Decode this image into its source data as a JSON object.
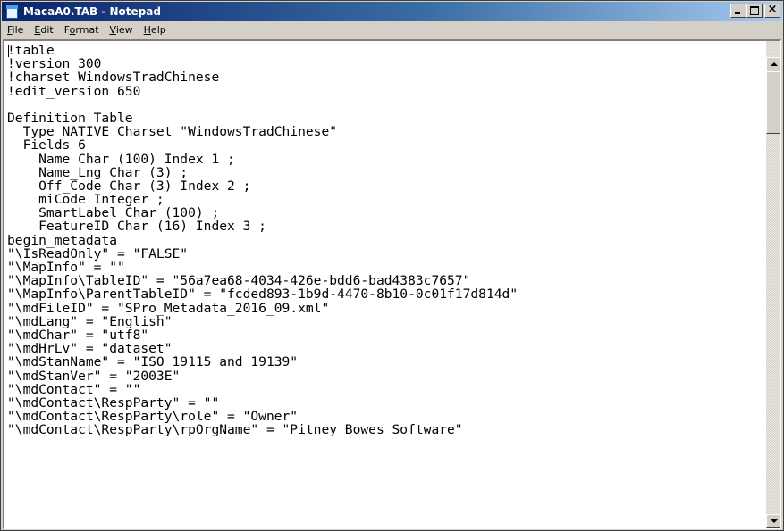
{
  "window": {
    "title": "MacaA0.TAB - Notepad",
    "icon": "notepad-icon",
    "colors": {
      "title_bar_start": "#0a246a",
      "title_bar_end": "#a6caf0",
      "chrome": "#d4d0c8",
      "text_background": "#ffffff"
    }
  },
  "caption_buttons": {
    "minimize": "minimize-icon",
    "maximize": "maximize-icon",
    "close": "close-icon",
    "close_glyph": "×"
  },
  "menu": [
    {
      "accel": "F",
      "rest": "ile"
    },
    {
      "accel": "E",
      "rest": "dit"
    },
    {
      "pre": "F",
      "accel": "o",
      "rest": "rmat"
    },
    {
      "accel": "V",
      "rest": "iew"
    },
    {
      "accel": "H",
      "rest": "elp"
    }
  ],
  "document": {
    "lines": [
      "!table",
      "!version 300",
      "!charset WindowsTradChinese",
      "!edit_version 650",
      "",
      "Definition Table",
      "  Type NATIVE Charset \"WindowsTradChinese\"",
      "  Fields 6",
      "    Name Char (100) Index 1 ;",
      "    Name_Lng Char (3) ;",
      "    Off_Code Char (3) Index 2 ;",
      "    miCode Integer ;",
      "    SmartLabel Char (100) ;",
      "    FeatureID Char (16) Index 3 ;",
      "begin_metadata",
      "\"\\IsReadOnly\" = \"FALSE\"",
      "\"\\MapInfo\" = \"\"",
      "\"\\MapInfo\\TableID\" = \"56a7ea68-4034-426e-bdd6-bad4383c7657\"",
      "\"\\MapInfo\\ParentTableID\" = \"fcded893-1b9d-4470-8b10-0c01f17d814d\"",
      "\"\\mdFileID\" = \"SPro_Metadata_2016_09.xml\"",
      "\"\\mdLang\" = \"English\"",
      "\"\\mdChar\" = \"utf8\"",
      "\"\\mdHrLv\" = \"dataset\"",
      "\"\\mdStanName\" = \"ISO 19115 and 19139\"",
      "\"\\mdStanVer\" = \"2003E\"",
      "\"\\mdContact\" = \"\"",
      "\"\\mdContact\\RespParty\" = \"\"",
      "\"\\mdContact\\RespParty\\role\" = \"Owner\"",
      "\"\\mdContact\\RespParty\\rpOrgName\" = \"Pitney Bowes Software\""
    ]
  },
  "scrollbar": {
    "up_icon": "scroll-up-arrow-icon",
    "down_icon": "scroll-down-arrow-icon",
    "position_fraction": 0.0
  }
}
